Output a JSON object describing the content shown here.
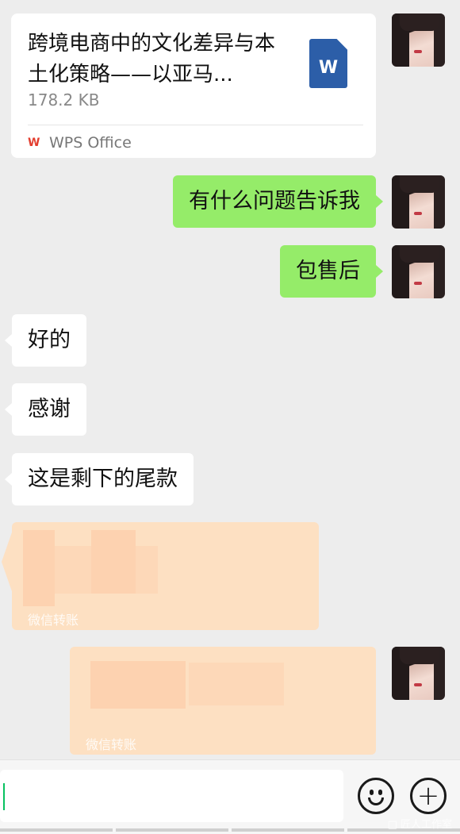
{
  "file_message": {
    "title": "跨境电商中的文化差异与本土化策略——以亚马...",
    "size": "178.2 KB",
    "icon_letter": "W",
    "source_logo": "W",
    "source_label": "WPS Office"
  },
  "messages": [
    {
      "side": "out",
      "text": "有什么问题告诉我"
    },
    {
      "side": "out",
      "text": "包售后"
    },
    {
      "side": "in",
      "text": "好的"
    },
    {
      "side": "in",
      "text": "感谢"
    },
    {
      "side": "in",
      "text": "这是剩下的尾款"
    }
  ],
  "transfers": [
    {
      "side": "in",
      "label": "微信转账"
    },
    {
      "side": "out",
      "label": "微信转账"
    }
  ],
  "input_bar": {
    "value": "",
    "emoji_icon": "emoji-icon",
    "plus_icon": "plus-icon"
  },
  "watermark": "□ 匠人工作室"
}
